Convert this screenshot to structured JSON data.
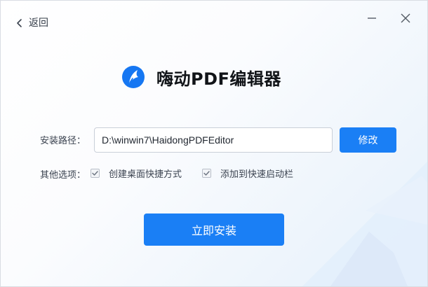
{
  "header": {
    "back_label": "返回",
    "back_icon": "chevron-left-icon",
    "minimize_icon": "minimize-icon",
    "close_icon": "close-icon"
  },
  "brand": {
    "logo_icon": "haidong-logo-icon",
    "app_name": "嗨动PDF编辑器"
  },
  "install_path": {
    "label": "安装路径：",
    "value": "D:\\winwin7\\HaidongPDFEditor",
    "modify_label": "修改"
  },
  "options": {
    "label": "其他选项：",
    "items": [
      {
        "label": "创建桌面快捷方式",
        "checked": true
      },
      {
        "label": "添加到快速启动栏",
        "checked": true
      }
    ]
  },
  "install_button_label": "立即安装",
  "colors": {
    "accent": "#1a7ff5",
    "text": "#3b4350",
    "title": "#111418"
  }
}
